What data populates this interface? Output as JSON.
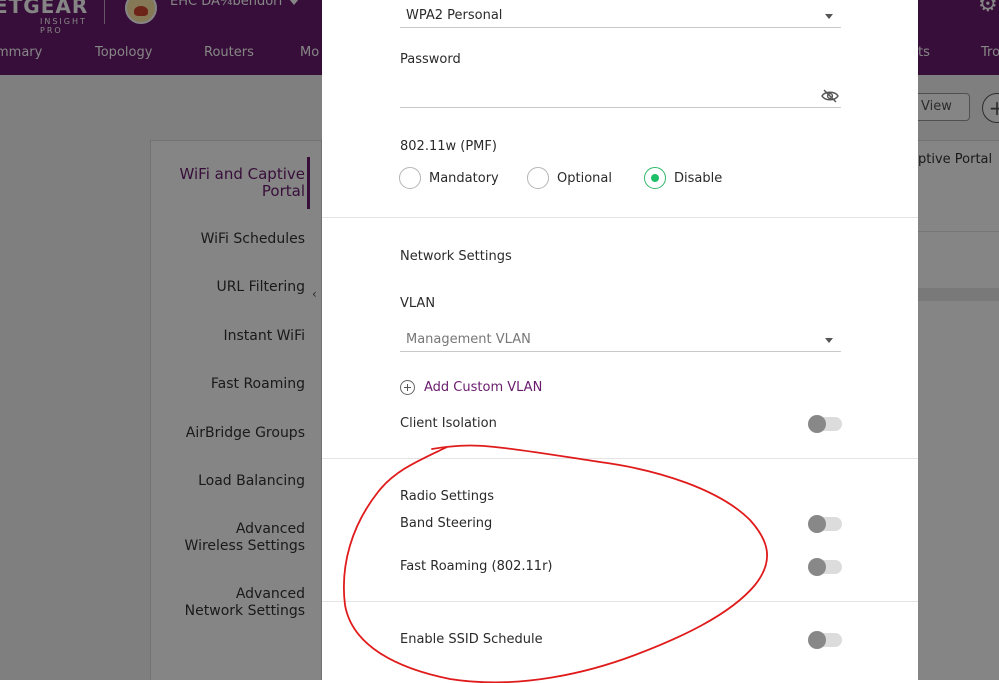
{
  "header": {
    "logo_brand": "ETGEAR",
    "logo_sub": "INSIGHT PRO",
    "org_name": "EHC DA¼bendorf"
  },
  "nav": {
    "tabs": [
      "mmary",
      "Topology",
      "Routers",
      "Mo",
      "ts",
      "Tro"
    ]
  },
  "sidebar": {
    "items": [
      "WiFi and Captive Portal",
      "WiFi Schedules",
      "URL Filtering",
      "Instant WiFi",
      "Fast Roaming",
      "AirBridge Groups",
      "Load Balancing",
      "Advanced Wireless Settings",
      "Advanced Network Settings"
    ],
    "active_index": 0
  },
  "background_right": {
    "view_button": "View",
    "plus_button": "+",
    "column_header": "ptive Portal"
  },
  "modal": {
    "security_select": "WPA2 Personal",
    "password_label": "Password",
    "password_value": "",
    "pmf_label": "802.11w (PMF)",
    "pmf_options": [
      "Mandatory",
      "Optional",
      "Disable"
    ],
    "pmf_selected": "Disable",
    "network_settings_title": "Network Settings",
    "vlan_label": "VLAN",
    "vlan_select": "Management VLAN",
    "add_custom_vlan": "Add Custom VLAN",
    "client_isolation_label": "Client Isolation",
    "client_isolation_on": false,
    "radio_settings_title": "Radio Settings",
    "band_steering_label": "Band Steering",
    "band_steering_on": false,
    "fast_roaming_label": "Fast Roaming (802.11r)",
    "fast_roaming_on": false,
    "ssid_schedule_label": "Enable SSID Schedule",
    "ssid_schedule_on": false
  },
  "colors": {
    "brand_purple": "#6a1b6e",
    "radio_selected": "#1fbf6a",
    "annotation_red": "#e01b1b"
  }
}
